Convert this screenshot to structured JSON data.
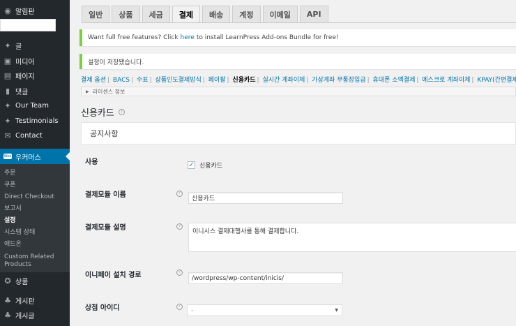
{
  "sidebar": {
    "dashboard": "알림판",
    "menu": [
      {
        "label": "글",
        "icon": "pushpin-icon"
      },
      {
        "label": "미디어",
        "icon": "media-icon"
      },
      {
        "label": "페이지",
        "icon": "page-icon"
      },
      {
        "label": "댓글",
        "icon": "comment-icon"
      },
      {
        "label": "Our Team",
        "icon": "pushpin-icon"
      },
      {
        "label": "Testimonials",
        "icon": "pushpin-icon"
      },
      {
        "label": "Contact",
        "icon": "mail-icon"
      }
    ],
    "woocommerce": "우커머스",
    "woocommerce_badge": "Woo",
    "submenu": [
      "주문",
      "쿠폰",
      "Direct Checkout",
      "보고서",
      "설정",
      "시스템 상태",
      "애드온",
      "Custom Related Products"
    ],
    "after": [
      {
        "label": "상품",
        "icon": "product-icon"
      },
      {
        "label": "게시판",
        "icon": "board-icon"
      },
      {
        "label": "게시글",
        "icon": "post-icon"
      }
    ]
  },
  "tabs": [
    "일반",
    "상품",
    "세금",
    "결제",
    "배송",
    "계정",
    "이메일",
    "API"
  ],
  "active_tab": "결제",
  "notice1": {
    "before": "Want full free features? Click ",
    "link": "here",
    "after": " to install LearnPress Add-ons Bundle for free!"
  },
  "notice2": "설정이 저장됐습니다.",
  "subnav": [
    "결제 옵션",
    "BACS",
    "수표",
    "상품인도결제방식",
    "페이팔",
    "신용카드",
    "실시간 계좌이체",
    "가상계좌 무통장입금",
    "휴대폰 소액결제",
    "에스크로 계좌이체",
    "KPAY(간편결제)"
  ],
  "subnav_current": "신용카드",
  "license_label": "라이센스 정보",
  "section_title": "신용카드",
  "notice_box": "공지사항",
  "form": {
    "enable_label": "사용",
    "enable_checkbox": "신용카드",
    "title_label": "결제모듈 이름",
    "title_value": "신용카드",
    "desc_label": "결제모듈 설명",
    "desc_value": "이니시스 결제대행사를 통해 결제합니다.",
    "path_label": "이니페이 설치 경로",
    "path_value": "/wordpress/wp-content/inicis/",
    "mid_label": "상점 아이디",
    "mid_value": "-"
  },
  "colors": {
    "sidebar_bg": "#23282d",
    "accent": "#0073aa",
    "notice_border": "#7ad03a"
  }
}
